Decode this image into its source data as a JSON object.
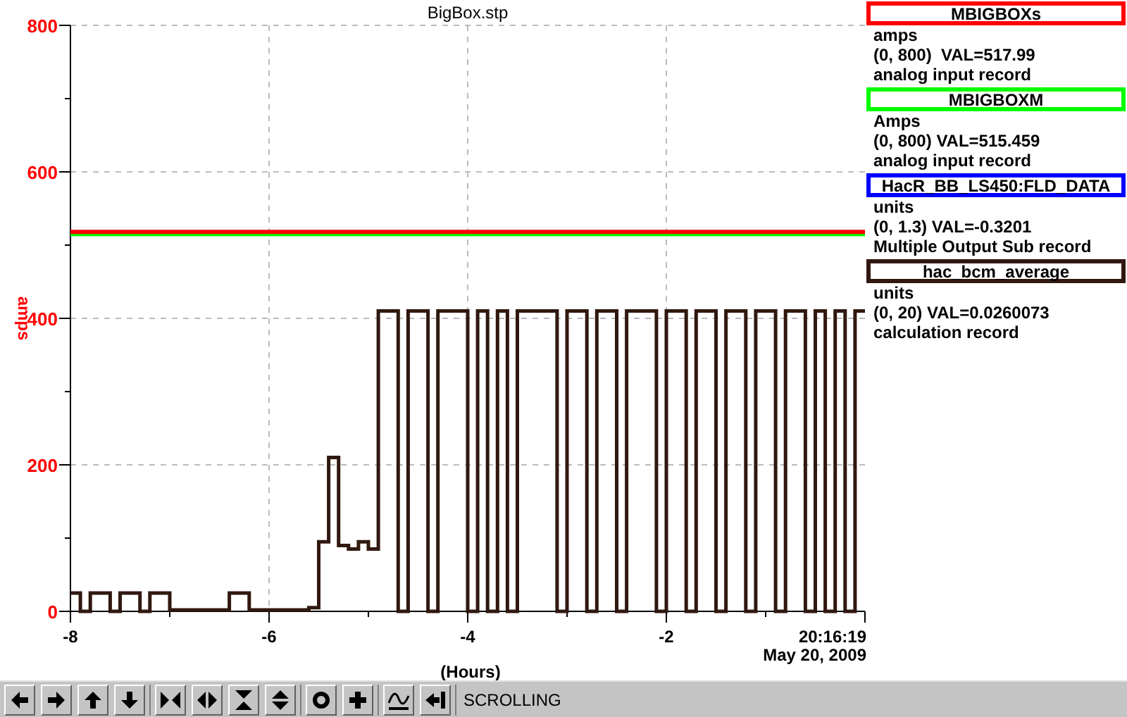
{
  "plot": {
    "chart_data": {
      "type": "line",
      "title": "BigBox.stp",
      "xlabel": "(Hours)",
      "ylabel": "amps",
      "grid": true,
      "x": [
        -8,
        -7.9,
        -7.9,
        -7.8,
        -7.8,
        -7.6,
        -7.6,
        -7.5,
        -7.5,
        -7.3,
        -7.3,
        -7.2,
        -7.2,
        -7,
        -7,
        -6.4,
        -6.4,
        -6.2,
        -6.2,
        -5.6,
        -5.6,
        -5.5,
        -5.5,
        -5.4,
        -5.4,
        -5.3,
        -5.3,
        -5.2,
        -5.2,
        -5.1,
        -5.1,
        -5,
        -5,
        -4.9,
        -4.9,
        -4.7,
        -4.7,
        -4.6,
        -4.6,
        -4.4,
        -4.4,
        -4.3,
        -4.3,
        -4,
        -4,
        -3.9,
        -3.9,
        -3.8,
        -3.8,
        -3.7,
        -3.7,
        -3.6,
        -3.6,
        -3.5,
        -3.5,
        -3.1,
        -3.1,
        -3,
        -3,
        -2.8,
        -2.8,
        -2.7,
        -2.7,
        -2.5,
        -2.5,
        -2.4,
        -2.4,
        -2.1,
        -2.1,
        -2,
        -2,
        -1.8,
        -1.8,
        -1.7,
        -1.7,
        -1.5,
        -1.5,
        -1.4,
        -1.4,
        -1.2,
        -1.2,
        -1.1,
        -1.1,
        -0.9,
        -0.9,
        -0.8,
        -0.8,
        -0.6,
        -0.6,
        -0.5,
        -0.5,
        -0.4,
        -0.4,
        -0.3,
        -0.3,
        -0.2,
        -0.2,
        -0.1,
        -0.1,
        0
      ],
      "series": [
        {
          "name": "MBIGBOXM",
          "color": "#00ff00",
          "values": [
            515,
            515,
            515,
            515,
            515,
            515,
            515,
            515,
            515,
            515,
            515,
            515,
            515,
            515,
            515,
            515,
            515,
            515,
            515,
            515,
            515,
            515,
            515,
            515,
            515,
            515,
            515,
            515,
            515,
            515,
            515,
            515,
            515,
            515,
            515,
            515,
            515,
            515,
            515,
            515,
            515,
            515,
            515,
            515,
            515,
            515,
            515,
            515,
            515,
            515,
            515,
            515,
            515,
            515,
            515,
            515,
            515,
            515,
            515,
            515,
            515,
            515,
            515,
            515,
            515,
            515,
            515,
            515,
            515,
            515,
            515,
            515,
            515,
            515,
            515,
            515,
            515,
            515,
            515,
            515,
            515,
            515,
            515,
            515,
            515,
            515,
            515,
            515,
            515,
            515,
            515,
            515,
            515,
            515,
            515,
            515,
            515,
            515,
            515,
            515
          ]
        },
        {
          "name": "MBIGBOXs",
          "color": "#ff0000",
          "values": [
            518,
            518,
            518,
            518,
            518,
            518,
            518,
            518,
            518,
            518,
            518,
            518,
            518,
            518,
            518,
            518,
            518,
            518,
            518,
            518,
            518,
            518,
            518,
            518,
            518,
            518,
            518,
            518,
            518,
            518,
            518,
            518,
            518,
            518,
            518,
            518,
            518,
            518,
            518,
            518,
            518,
            518,
            518,
            518,
            518,
            518,
            518,
            518,
            518,
            518,
            518,
            518,
            518,
            518,
            518,
            518,
            518,
            518,
            518,
            518,
            518,
            518,
            518,
            518,
            518,
            518,
            518,
            518,
            518,
            518,
            518,
            518,
            518,
            518,
            518,
            518,
            518,
            518,
            518,
            518,
            518,
            518,
            518,
            518,
            518,
            518,
            518,
            518,
            518,
            518,
            518,
            518,
            518,
            518,
            518,
            518,
            518,
            518,
            518,
            518
          ]
        },
        {
          "name": "hac_bcm_average",
          "color": "#301810",
          "values": [
            25,
            25,
            0,
            0,
            25,
            25,
            0,
            0,
            25,
            25,
            0,
            0,
            25,
            25,
            2,
            2,
            25,
            25,
            2,
            2,
            5,
            5,
            95,
            95,
            210,
            210,
            90,
            90,
            85,
            85,
            95,
            95,
            85,
            85,
            410,
            410,
            0,
            0,
            410,
            410,
            0,
            0,
            410,
            410,
            0,
            0,
            410,
            410,
            0,
            0,
            410,
            410,
            0,
            0,
            410,
            410,
            0,
            0,
            410,
            410,
            0,
            0,
            410,
            410,
            0,
            0,
            410,
            410,
            0,
            0,
            410,
            410,
            0,
            0,
            410,
            410,
            0,
            0,
            410,
            410,
            0,
            0,
            410,
            410,
            0,
            0,
            410,
            410,
            0,
            0,
            410,
            410,
            0,
            0,
            410,
            410,
            0,
            0,
            410,
            410
          ]
        }
      ],
      "xlim": [
        -8,
        0
      ],
      "ylim": [
        0,
        800
      ],
      "xticks": [
        -8,
        -6,
        -4,
        -2
      ],
      "yticks": [
        0,
        200,
        400,
        600,
        800
      ]
    },
    "end_time": "20:16:19",
    "date_label": "May 20, 2009"
  },
  "legend": [
    {
      "units": "amps",
      "limits_value": "(0, 800)  VAL=517.99",
      "record_type": "analog input record"
    },
    {
      "units": "Amps",
      "limits_value": "(0, 800) VAL=515.459",
      "record_type": "analog input record"
    },
    {
      "name": "HacR_BB_LS450:FLD_DATA",
      "color": "#0000ff",
      "units": "units",
      "limits_value": "(0, 1.3) VAL=-0.3201",
      "record_type": "Multiple Output Sub record"
    },
    {
      "units": "units",
      "limits_value": "(0, 20) VAL=0.0260073",
      "record_type": "calculation record"
    }
  ],
  "toolbar": {
    "groups": [
      [
        {
          "kind": "left"
        },
        {
          "kind": "right"
        },
        {
          "kind": "up"
        },
        {
          "kind": "down"
        }
      ],
      [
        {
          "kind": "compress-h"
        },
        {
          "kind": "expand-h"
        },
        {
          "kind": "compress-v"
        },
        {
          "kind": "expand-v"
        }
      ],
      [
        {
          "kind": "circle"
        },
        {
          "kind": "plus"
        }
      ],
      [
        {
          "kind": "wave"
        },
        {
          "kind": "back"
        }
      ]
    ],
    "mode": "SCROLLING"
  }
}
